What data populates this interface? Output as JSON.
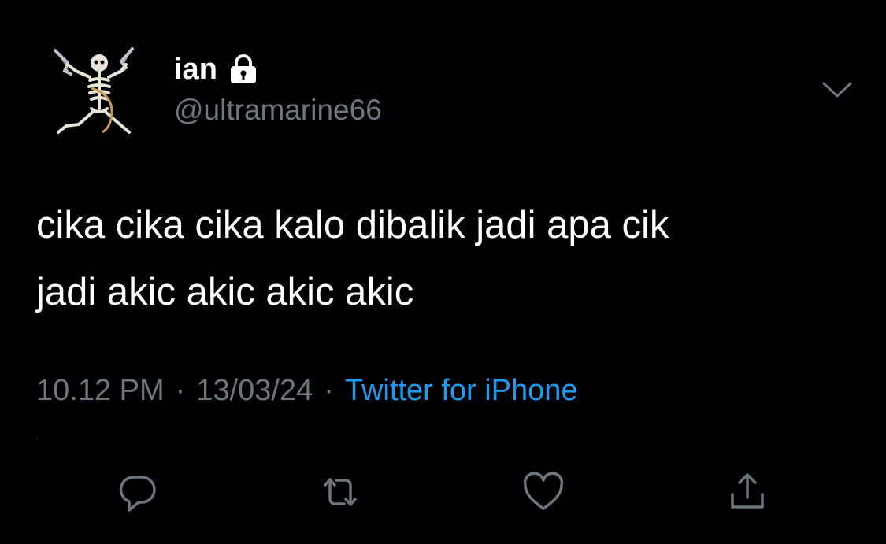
{
  "user": {
    "display_name": "ian",
    "handle": "@ultramarine66",
    "avatar_icon": "skeleton-with-guns-avatar",
    "protected_icon": "lock-icon"
  },
  "tweet": {
    "lines": [
      "cika cika cika kalo dibalik jadi apa cik",
      "jadi akic akic akic akic"
    ]
  },
  "meta": {
    "time": "10.12 PM",
    "separator": "·",
    "date": "13/03/24",
    "source": "Twitter for iPhone"
  },
  "actions": {
    "reply_icon": "reply-icon",
    "retweet_icon": "retweet-icon",
    "like_icon": "heart-icon",
    "share_icon": "share-icon",
    "more_icon": "chevron-down-icon"
  },
  "colors": {
    "background": "#000000",
    "text": "#ffffff",
    "muted": "#6e767d",
    "link": "#1d9bf0",
    "divider": "#2f3336"
  }
}
